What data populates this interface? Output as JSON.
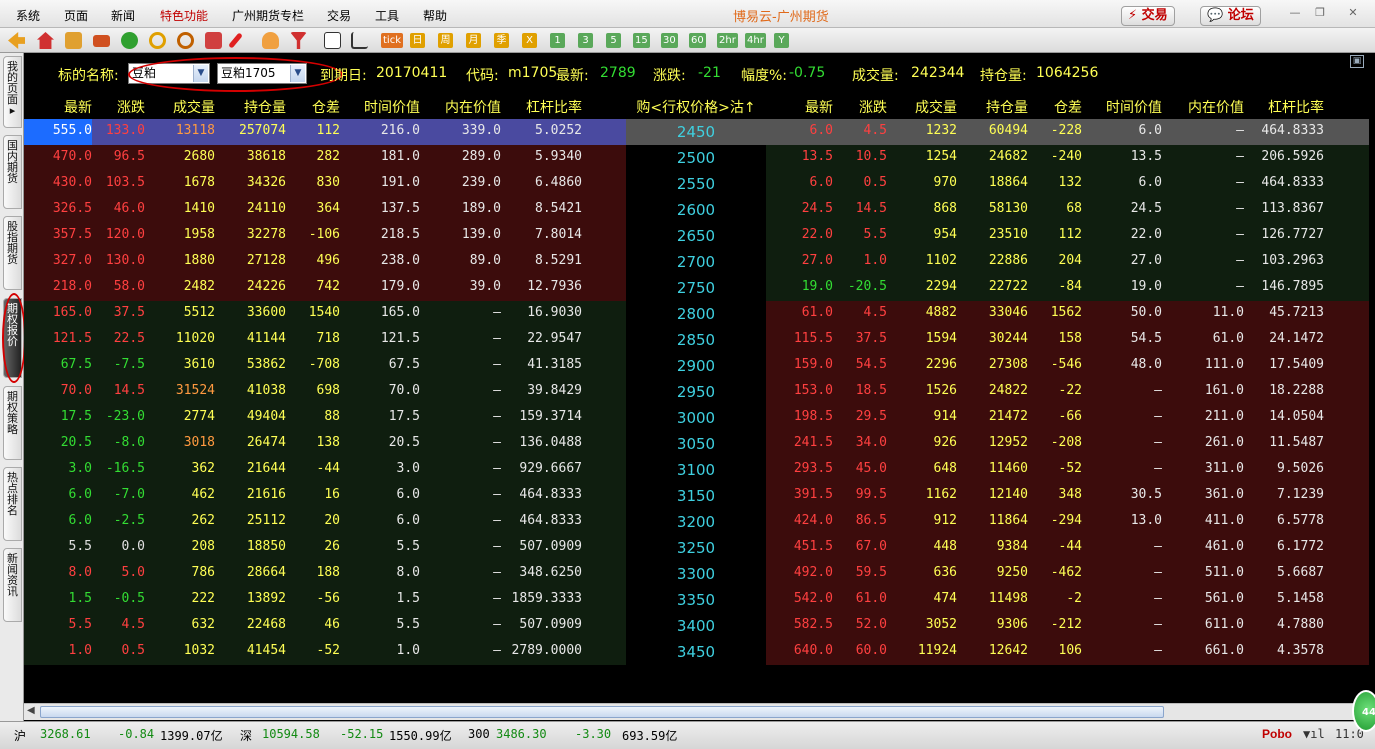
{
  "window": {
    "title": "博易云-广州期货",
    "trade_btn": "交易",
    "forum_btn": "论坛"
  },
  "menu": [
    "系统",
    "页面",
    "新闻",
    "特色功能",
    "广州期货专栏",
    "交易",
    "工具",
    "帮助"
  ],
  "toolbar_labels": [
    "tick",
    "日",
    "周",
    "月",
    "季",
    "X",
    "1",
    "3",
    "5",
    "15",
    "30",
    "60",
    "2hr",
    "4hr",
    "Y"
  ],
  "sidebar_tabs": [
    "我的页面",
    "国内期货",
    "股指期货",
    "期权报价",
    "期权策略",
    "热点排名",
    "新闻资讯"
  ],
  "info": {
    "label_name": "标的名称:",
    "select_product": "豆粕",
    "select_contract": "豆粕1705",
    "expiry_label": "到期日:",
    "expiry": "20170411",
    "code_label": "代码:",
    "code": "m1705",
    "last_label": "最新:",
    "last": "2789",
    "change_label": "涨跌:",
    "change": "-21",
    "pct_label": "幅度%:",
    "pct": "-0.75",
    "vol_label": "成交量:",
    "vol": "242344",
    "oi_label": "持仓量:",
    "oi": "1064256"
  },
  "headers": {
    "call": [
      "最新",
      "涨跌",
      "成交量",
      "持仓量",
      "仓差",
      "时间价值",
      "内在价值",
      "杠杆比率"
    ],
    "strike": "购<行权价格>沽↑",
    "put": [
      "最新",
      "涨跌",
      "成交量",
      "持仓量",
      "仓差",
      "时间价值",
      "内在价值",
      "杠杆比率"
    ]
  },
  "rows": [
    {
      "call": [
        "555.0",
        "133.0",
        "13118",
        "257074",
        "112",
        "216.0",
        "339.0",
        "5.0252"
      ],
      "strike": "2450",
      "put": [
        "6.0",
        "4.5",
        "1232",
        "60494",
        "-228",
        "6.0",
        "—",
        "464.8333"
      ]
    },
    {
      "call": [
        "470.0",
        "96.5",
        "2680",
        "38618",
        "282",
        "181.0",
        "289.0",
        "5.9340"
      ],
      "strike": "2500",
      "put": [
        "13.5",
        "10.5",
        "1254",
        "24682",
        "-240",
        "13.5",
        "—",
        "206.5926"
      ]
    },
    {
      "call": [
        "430.0",
        "103.5",
        "1678",
        "34326",
        "830",
        "191.0",
        "239.0",
        "6.4860"
      ],
      "strike": "2550",
      "put": [
        "6.0",
        "0.5",
        "970",
        "18864",
        "132",
        "6.0",
        "—",
        "464.8333"
      ]
    },
    {
      "call": [
        "326.5",
        "46.0",
        "1410",
        "24110",
        "364",
        "137.5",
        "189.0",
        "8.5421"
      ],
      "strike": "2600",
      "put": [
        "24.5",
        "14.5",
        "868",
        "58130",
        "68",
        "24.5",
        "—",
        "113.8367"
      ]
    },
    {
      "call": [
        "357.5",
        "120.0",
        "1958",
        "32278",
        "-106",
        "218.5",
        "139.0",
        "7.8014"
      ],
      "strike": "2650",
      "put": [
        "22.0",
        "5.5",
        "954",
        "23510",
        "112",
        "22.0",
        "—",
        "126.7727"
      ]
    },
    {
      "call": [
        "327.0",
        "130.0",
        "1880",
        "27128",
        "496",
        "238.0",
        "89.0",
        "8.5291"
      ],
      "strike": "2700",
      "put": [
        "27.0",
        "1.0",
        "1102",
        "22886",
        "204",
        "27.0",
        "—",
        "103.2963"
      ]
    },
    {
      "call": [
        "218.0",
        "58.0",
        "2482",
        "24226",
        "742",
        "179.0",
        "39.0",
        "12.7936"
      ],
      "strike": "2750",
      "put": [
        "19.0",
        "-20.5",
        "2294",
        "22722",
        "-84",
        "19.0",
        "—",
        "146.7895"
      ]
    },
    {
      "call": [
        "165.0",
        "37.5",
        "5512",
        "33600",
        "1540",
        "165.0",
        "—",
        "16.9030"
      ],
      "strike": "2800",
      "put": [
        "61.0",
        "4.5",
        "4882",
        "33046",
        "1562",
        "50.0",
        "11.0",
        "45.7213"
      ]
    },
    {
      "call": [
        "121.5",
        "22.5",
        "11020",
        "41144",
        "718",
        "121.5",
        "—",
        "22.9547"
      ],
      "strike": "2850",
      "put": [
        "115.5",
        "37.5",
        "1594",
        "30244",
        "158",
        "54.5",
        "61.0",
        "24.1472"
      ]
    },
    {
      "call": [
        "67.5",
        "-7.5",
        "3610",
        "53862",
        "-708",
        "67.5",
        "—",
        "41.3185"
      ],
      "strike": "2900",
      "put": [
        "159.0",
        "54.5",
        "2296",
        "27308",
        "-546",
        "48.0",
        "111.0",
        "17.5409"
      ]
    },
    {
      "call": [
        "70.0",
        "14.5",
        "31524",
        "41038",
        "698",
        "70.0",
        "—",
        "39.8429"
      ],
      "strike": "2950",
      "put": [
        "153.0",
        "18.5",
        "1526",
        "24822",
        "-22",
        "—",
        "161.0",
        "18.2288"
      ]
    },
    {
      "call": [
        "17.5",
        "-23.0",
        "2774",
        "49404",
        "88",
        "17.5",
        "—",
        "159.3714"
      ],
      "strike": "3000",
      "put": [
        "198.5",
        "29.5",
        "914",
        "21472",
        "-66",
        "—",
        "211.0",
        "14.0504"
      ]
    },
    {
      "call": [
        "20.5",
        "-8.0",
        "3018",
        "26474",
        "138",
        "20.5",
        "—",
        "136.0488"
      ],
      "strike": "3050",
      "put": [
        "241.5",
        "34.0",
        "926",
        "12952",
        "-208",
        "—",
        "261.0",
        "11.5487"
      ]
    },
    {
      "call": [
        "3.0",
        "-16.5",
        "362",
        "21644",
        "-44",
        "3.0",
        "—",
        "929.6667"
      ],
      "strike": "3100",
      "put": [
        "293.5",
        "45.0",
        "648",
        "11460",
        "-52",
        "—",
        "311.0",
        "9.5026"
      ]
    },
    {
      "call": [
        "6.0",
        "-7.0",
        "462",
        "21616",
        "16",
        "6.0",
        "—",
        "464.8333"
      ],
      "strike": "3150",
      "put": [
        "391.5",
        "99.5",
        "1162",
        "12140",
        "348",
        "30.5",
        "361.0",
        "7.1239"
      ]
    },
    {
      "call": [
        "6.0",
        "-2.5",
        "262",
        "25112",
        "20",
        "6.0",
        "—",
        "464.8333"
      ],
      "strike": "3200",
      "put": [
        "424.0",
        "86.5",
        "912",
        "11864",
        "-294",
        "13.0",
        "411.0",
        "6.5778"
      ]
    },
    {
      "call": [
        "5.5",
        "0.0",
        "208",
        "18850",
        "26",
        "5.5",
        "—",
        "507.0909"
      ],
      "strike": "3250",
      "put": [
        "451.5",
        "67.0",
        "448",
        "9384",
        "-44",
        "—",
        "461.0",
        "6.1772"
      ]
    },
    {
      "call": [
        "8.0",
        "5.0",
        "786",
        "28664",
        "188",
        "8.0",
        "—",
        "348.6250"
      ],
      "strike": "3300",
      "put": [
        "492.0",
        "59.5",
        "636",
        "9250",
        "-462",
        "—",
        "511.0",
        "5.6687"
      ]
    },
    {
      "call": [
        "1.5",
        "-0.5",
        "222",
        "13892",
        "-56",
        "1.5",
        "—",
        "1859.3333"
      ],
      "strike": "3350",
      "put": [
        "542.0",
        "61.0",
        "474",
        "11498",
        "-2",
        "—",
        "561.0",
        "5.1458"
      ]
    },
    {
      "call": [
        "5.5",
        "4.5",
        "632",
        "22468",
        "46",
        "5.5",
        "—",
        "507.0909"
      ],
      "strike": "3400",
      "put": [
        "582.5",
        "52.0",
        "3052",
        "9306",
        "-212",
        "—",
        "611.0",
        "4.7880"
      ]
    },
    {
      "call": [
        "1.0",
        "0.5",
        "1032",
        "41454",
        "-52",
        "1.0",
        "—",
        "2789.0000"
      ],
      "strike": "3450",
      "put": [
        "640.0",
        "60.0",
        "11924",
        "12642",
        "106",
        "—",
        "661.0",
        "4.3578"
      ]
    }
  ],
  "status": {
    "sh_label": "沪",
    "sh_index": "3268.61",
    "sh_change": "-0.84",
    "sh_amount": "1399.07亿",
    "sz_label": "深",
    "sz_index": "10594.58",
    "sz_change": "-52.15",
    "sz_amount": "1550.99亿",
    "hs_label": "300",
    "hs_index": "3486.30",
    "hs_change": "-3.30",
    "hs_amount": "693.59亿",
    "brand": "Pobo",
    "time": "11:0",
    "badge": "44"
  },
  "colors": {
    "up": "#ff4040",
    "down": "#33dd33",
    "flat": "#e0e0e0",
    "yellow": "#ffff55",
    "cyan": "#3fd0e0",
    "itm_bg": "#3c0c0c",
    "otm_bg": "#0f1e0f",
    "highlight": "#4a4aa0"
  }
}
